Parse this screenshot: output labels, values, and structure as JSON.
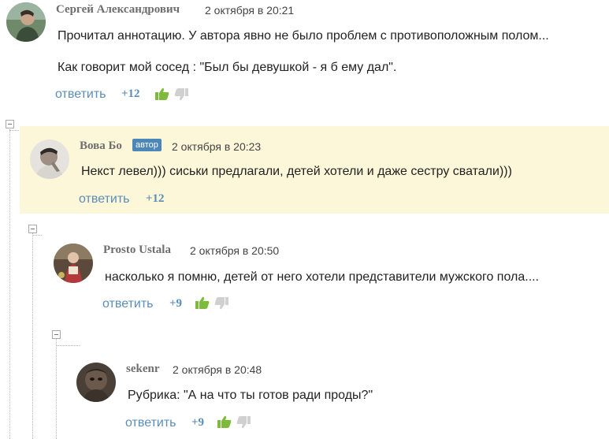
{
  "comments": [
    {
      "author": "Сергей Александрович",
      "date": "2 октября в 20:21",
      "text_lines": [
        "Прочитал аннотацию. У автора явно не было проблем с противоположным полом...",
        "Как говорит мой сосед : \"Был бы девушкой - я б ему дал\"."
      ],
      "reply_label": "ответить",
      "score": "+12",
      "votes_shown": true
    },
    {
      "author": "Вова Бо",
      "badge": "автор",
      "date": "2 октября в 20:23",
      "text_lines": [
        "Некст левел))) сиськи предлагали, детей хотели и даже сестру сватали)))"
      ],
      "reply_label": "ответить",
      "score": "+12",
      "votes_shown": false,
      "highlighted": true
    },
    {
      "author": "Prosto Ustala",
      "date": "2 октября в 20:50",
      "text_lines": [
        "насколько я помню, детей от него хотели представители мужского пола...."
      ],
      "reply_label": "ответить",
      "score": "+9",
      "votes_shown": true
    },
    {
      "author": "sekenr",
      "date": "2 октября в 20:48",
      "text_lines": [
        "Рубрика: \"А на что ты готов ради проды?\""
      ],
      "reply_label": "ответить",
      "score": "+9",
      "votes_shown": true
    }
  ],
  "colors": {
    "link": "#5a8db8",
    "author": "#6e6e6e",
    "highlight_bg": "#fdf7d9",
    "badge_bg": "#4d86b8",
    "thumb_up": "#7dbb3c",
    "thumb_down": "#d0d0d0"
  },
  "icons": [
    "thumbs-up-icon",
    "thumbs-down-icon",
    "collapse-minus-icon"
  ]
}
